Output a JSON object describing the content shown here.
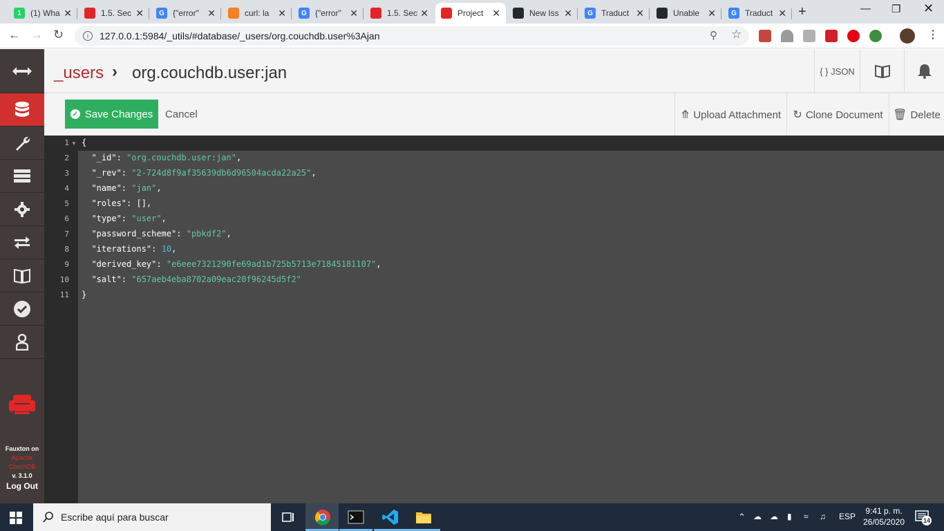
{
  "browser": {
    "tabs": [
      {
        "title": "(1) Wha",
        "favicon": "whatsapp-icon",
        "color": "#25d366",
        "glyph": "1"
      },
      {
        "title": "1.5. Sec",
        "favicon": "couchdb-icon",
        "color": "#e42528",
        "glyph": ""
      },
      {
        "title": "{\"error\"",
        "favicon": "google-icon",
        "color": "#4285f4",
        "glyph": "G"
      },
      {
        "title": "curl: la",
        "favicon": "stackoverflow-icon",
        "color": "#f48024",
        "glyph": ""
      },
      {
        "title": "{\"error\"",
        "favicon": "google-icon",
        "color": "#4285f4",
        "glyph": "G"
      },
      {
        "title": "1.5. Sec",
        "favicon": "couchdb-icon",
        "color": "#e42528",
        "glyph": ""
      },
      {
        "title": "Project",
        "favicon": "couchdb-icon",
        "color": "#e42528",
        "glyph": ""
      },
      {
        "title": "New Iss",
        "favicon": "github-icon",
        "color": "#24292e",
        "glyph": ""
      },
      {
        "title": "Traduct",
        "favicon": "google-translate-icon",
        "color": "#4285f4",
        "glyph": "G"
      },
      {
        "title": "Unable",
        "favicon": "github-icon",
        "color": "#24292e",
        "glyph": ""
      },
      {
        "title": "Traduct",
        "favicon": "google-translate-icon",
        "color": "#4285f4",
        "glyph": "G"
      }
    ],
    "active_tab": 6,
    "url": "127.0.0.1:5984/_utils/#database/_users/org.couchdb.user%3Ajan"
  },
  "header": {
    "database": "_users",
    "document": "org.couchdb.user:jan",
    "json_label": "{ } JSON"
  },
  "actions": {
    "save_label": "Save Changes",
    "cancel_label": "Cancel",
    "upload_label": "Upload Attachment",
    "clone_label": "Clone Document",
    "delete_label": "Delete"
  },
  "sidebar": {
    "brand_line1": "Fauxton on",
    "brand_line2": "Apache",
    "brand_line3": "CouchDB",
    "version": "v. 3.1.0",
    "logout": "Log Out"
  },
  "editor": {
    "lines": [
      [
        {
          "t": "p",
          "v": "{"
        }
      ],
      [
        {
          "t": "k",
          "v": "  \"_id\""
        },
        {
          "t": "p",
          "v": ": "
        },
        {
          "t": "s",
          "v": "\"org.couchdb.user:jan\""
        },
        {
          "t": "p",
          "v": ","
        }
      ],
      [
        {
          "t": "k",
          "v": "  \"_rev\""
        },
        {
          "t": "p",
          "v": ": "
        },
        {
          "t": "s",
          "v": "\"2-724d8f9af35639db6d96504acda22a25\""
        },
        {
          "t": "p",
          "v": ","
        }
      ],
      [
        {
          "t": "k",
          "v": "  \"name\""
        },
        {
          "t": "p",
          "v": ": "
        },
        {
          "t": "s",
          "v": "\"jan\""
        },
        {
          "t": "p",
          "v": ","
        }
      ],
      [
        {
          "t": "k",
          "v": "  \"roles\""
        },
        {
          "t": "p",
          "v": ": [],"
        }
      ],
      [
        {
          "t": "k",
          "v": "  \"type\""
        },
        {
          "t": "p",
          "v": ": "
        },
        {
          "t": "s",
          "v": "\"user\""
        },
        {
          "t": "p",
          "v": ","
        }
      ],
      [
        {
          "t": "k",
          "v": "  \"password_scheme\""
        },
        {
          "t": "p",
          "v": ": "
        },
        {
          "t": "s",
          "v": "\"pbkdf2\""
        },
        {
          "t": "p",
          "v": ","
        }
      ],
      [
        {
          "t": "k",
          "v": "  \"iterations\""
        },
        {
          "t": "p",
          "v": ": "
        },
        {
          "t": "n",
          "v": "10"
        },
        {
          "t": "p",
          "v": ","
        }
      ],
      [
        {
          "t": "k",
          "v": "  \"derived_key\""
        },
        {
          "t": "p",
          "v": ": "
        },
        {
          "t": "s",
          "v": "\"e6eee7321290fe69ad1b725b5713e71845181107\""
        },
        {
          "t": "p",
          "v": ","
        }
      ],
      [
        {
          "t": "k",
          "v": "  \"salt\""
        },
        {
          "t": "p",
          "v": ": "
        },
        {
          "t": "s",
          "v": "\"657aeb4eba8702a09eac20f96245d5f2\""
        }
      ],
      [
        {
          "t": "p",
          "v": "}"
        }
      ]
    ]
  },
  "taskbar": {
    "search_placeholder": "Escribe aquí para buscar",
    "language": "ESP",
    "time": "9:41 p. m.",
    "date": "26/05/2020",
    "notifications": "14"
  }
}
